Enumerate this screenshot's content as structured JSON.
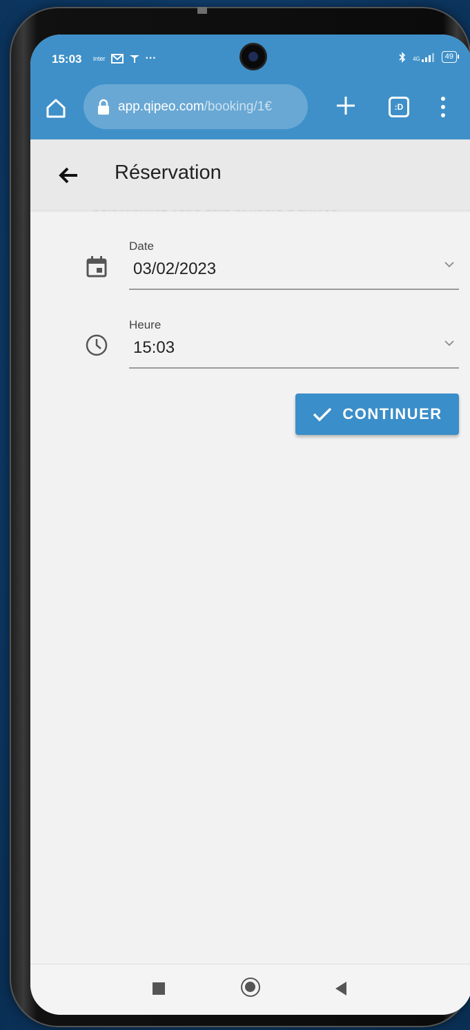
{
  "status_bar": {
    "time": "15:03",
    "left_icons": [
      "inter",
      "mail-icon",
      "twitter-icon",
      "···"
    ],
    "network": "4G",
    "battery": "49"
  },
  "browser": {
    "url_host": "app.qipeo.com",
    "url_path": "/booking/1€",
    "tabs_label": ":D"
  },
  "app_bar": {
    "title": "Réservation"
  },
  "form": {
    "faded_header": "Sélectionnez votre date et heure d'arrivée",
    "date": {
      "label": "Date",
      "value": "03/02/2023"
    },
    "time": {
      "label": "Heure",
      "value": "15:03"
    },
    "continue_label": "CONTINUER"
  },
  "colors": {
    "primary": "#3a8ec9",
    "chrome": "#3f90c8",
    "background": "#f2f2f2"
  }
}
